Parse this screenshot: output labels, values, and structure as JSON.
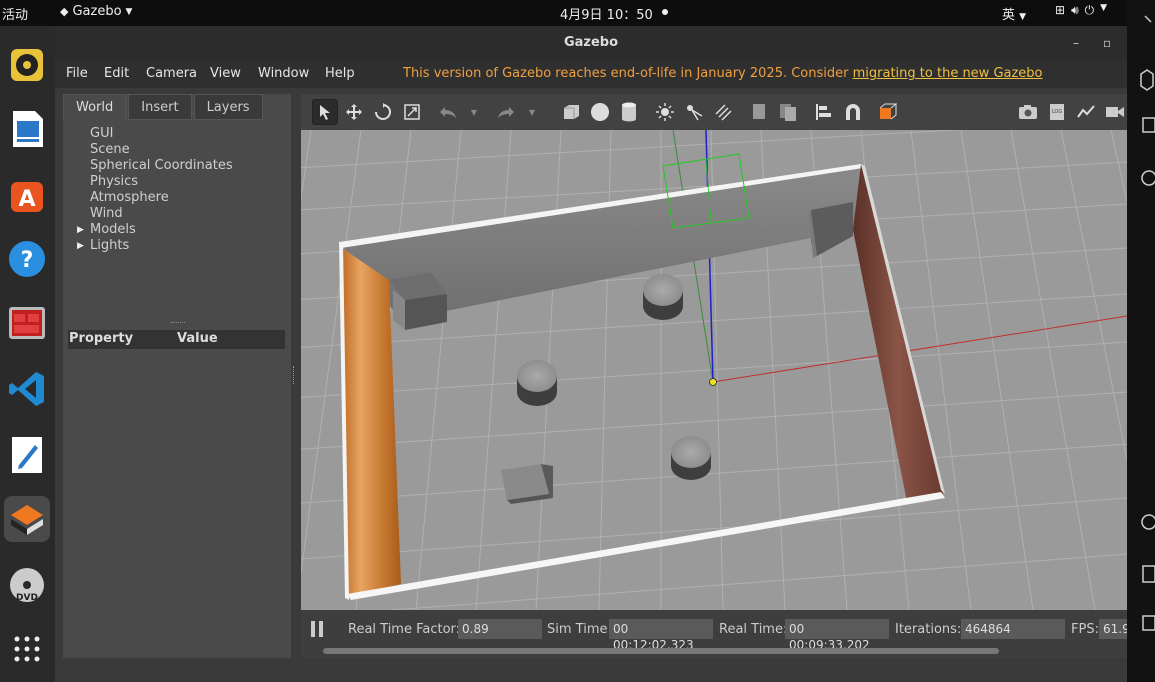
{
  "topbar": {
    "activities": "活动",
    "app_name": "Gazebo",
    "clock": "4月9日  10：50",
    "ime": "英"
  },
  "window": {
    "title": "Gazebo",
    "minimize": "–",
    "maximize": "▫"
  },
  "menu": {
    "items": [
      "File",
      "Edit",
      "Camera",
      "View",
      "Window",
      "Help"
    ],
    "eol_text": "This version of Gazebo reaches end-of-life in January 2025. Consider ",
    "eol_link": "migrating to the new Gazebo"
  },
  "leftpanel": {
    "tabs": [
      "World",
      "Insert",
      "Layers"
    ],
    "tree": [
      "GUI",
      "Scene",
      "Spherical Coordinates",
      "Physics",
      "Atmosphere",
      "Wind",
      "Models",
      "Lights"
    ],
    "property_header": "Property",
    "value_header": "Value"
  },
  "status": {
    "rtf_label": "Real Time Factor:",
    "rtf_value": "0.89",
    "sim_label": "Sim Time:",
    "sim_value": "00 00:12:02.323",
    "real_label": "Real Time:",
    "real_value": "00 00:09:33.202",
    "iter_label": "Iterations:",
    "iter_value": "464864",
    "fps_label": "FPS:",
    "fps_value": "61.9"
  },
  "colors": {
    "warning": "#f0a040",
    "accent": "#f07820",
    "viewport": "#9a9a9a"
  }
}
